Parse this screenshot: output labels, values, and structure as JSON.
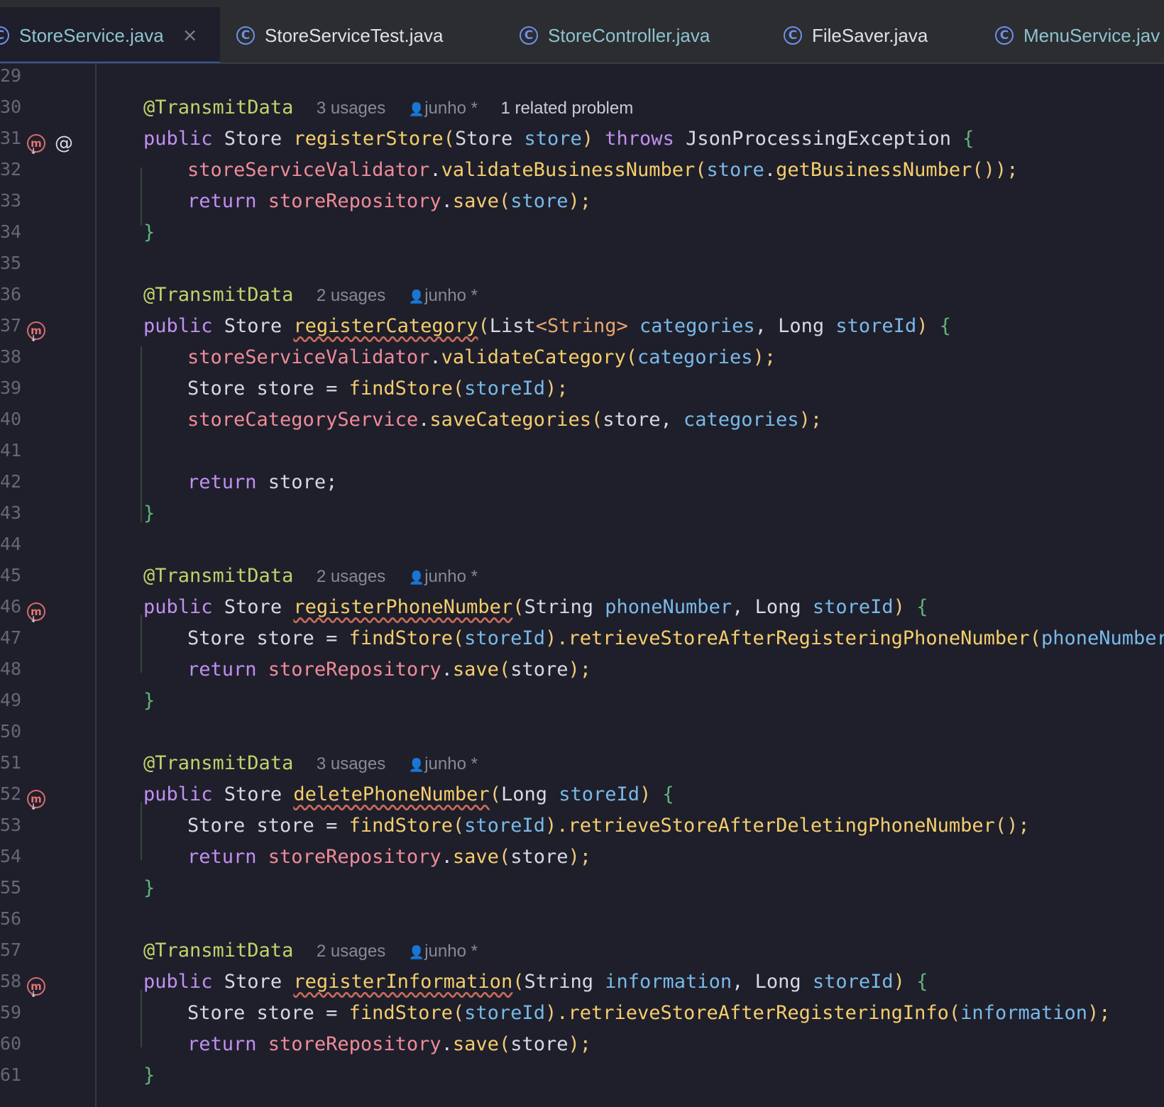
{
  "tabs": [
    {
      "label": "StoreService.java",
      "active": true,
      "close_icon": "×"
    },
    {
      "label": "StoreServiceTest.java"
    },
    {
      "label": "StoreController.java"
    },
    {
      "label": "FileSaver.java"
    },
    {
      "label": "MenuService.jav"
    }
  ],
  "tab_icon": "C",
  "gutter_icons": {
    "implements_method": "m",
    "annotation": "@"
  },
  "editor": {
    "lines": [
      {
        "n": "29"
      },
      {
        "n": "30",
        "annotation": "@TransmitData",
        "usages": "3 usages",
        "author": "junho *",
        "problem": "1 related problem"
      },
      {
        "n": "31",
        "type": "Store",
        "name": "registerStore",
        "params_open": "(",
        "p1type": "Store ",
        "p1": "store",
        "close": ")",
        "throws": " throws ",
        "exception": "JsonProcessingException ",
        "brace": "{"
      },
      {
        "n": "32",
        "field": "storeServiceValidator",
        "dot": ".",
        "call": "validateBusinessNumber",
        "open": "(",
        "arg": "store",
        "dot2": ".",
        "call2": "getBusinessNumber",
        "tail": "());"
      },
      {
        "n": "33",
        "ret": "return ",
        "field": "storeRepository",
        "dot": ".",
        "call": "save",
        "open": "(",
        "arg": "store",
        "tail": ");"
      },
      {
        "n": "34",
        "brace": "}"
      },
      {
        "n": "35"
      },
      {
        "n": "36",
        "annotation": "@TransmitData",
        "usages": "2 usages",
        "author": "junho *"
      },
      {
        "n": "37",
        "type": "Store",
        "name": "registerCategory",
        "p1type": "List",
        "gen": "<String>",
        "p1": "categories",
        "sep": ", ",
        "p2type": "Long ",
        "p2": "storeId",
        "brace": "{"
      },
      {
        "n": "38",
        "field": "storeServiceValidator",
        "dot": ".",
        "call": "validateCategory",
        "arg": "categories",
        "tail": ");"
      },
      {
        "n": "39",
        "decl": "Store store = ",
        "call": "findStore",
        "arg": "storeId",
        "tail": ");"
      },
      {
        "n": "40",
        "field": "storeCategoryService",
        "dot": ".",
        "call": "saveCategories",
        "plain": "store, ",
        "arg": "categories",
        "tail": ");"
      },
      {
        "n": "41"
      },
      {
        "n": "42",
        "ret": "return ",
        "plain": "store;"
      },
      {
        "n": "43",
        "brace": "}"
      },
      {
        "n": "44"
      },
      {
        "n": "45",
        "annotation": "@TransmitData",
        "usages": "2 usages",
        "author": "junho *"
      },
      {
        "n": "46",
        "type": "Store",
        "name": "registerPhoneNumber",
        "p1type": "String ",
        "p1": "phoneNumber",
        "sep": ", ",
        "p2type": "Long ",
        "p2": "storeId",
        "brace": "{"
      },
      {
        "n": "47",
        "decl": "Store store = ",
        "call": "findStore",
        "arg": "storeId",
        "dot": ").",
        "call2": "retrieveStoreAfterRegisteringPhoneNumber",
        "arg2": "phoneNumber",
        "tail": ");"
      },
      {
        "n": "48",
        "ret": "return ",
        "field": "storeRepository",
        "dot": ".",
        "call": "save",
        "plain": "store",
        "tail": ");"
      },
      {
        "n": "49",
        "brace": "}"
      },
      {
        "n": "50"
      },
      {
        "n": "51",
        "annotation": "@TransmitData",
        "usages": "3 usages",
        "author": "junho *"
      },
      {
        "n": "52",
        "type": "Store",
        "name": "deletePhoneNumber",
        "p1type": "Long ",
        "p1": "storeId",
        "brace": "{"
      },
      {
        "n": "53",
        "decl": "Store store = ",
        "call": "findStore",
        "arg": "storeId",
        "dot": ").",
        "call2": "retrieveStoreAfterDeletingPhoneNumber",
        "tail": "();"
      },
      {
        "n": "54",
        "ret": "return ",
        "field": "storeRepository",
        "dot": ".",
        "call": "save",
        "plain": "store",
        "tail": ");"
      },
      {
        "n": "55",
        "brace": "}"
      },
      {
        "n": "56"
      },
      {
        "n": "57",
        "annotation": "@TransmitData",
        "usages": "2 usages",
        "author": "junho *"
      },
      {
        "n": "58",
        "type": "Store",
        "name": "registerInformation",
        "p1type": "String ",
        "p1": "information",
        "sep": ", ",
        "p2type": "Long ",
        "p2": "storeId",
        "brace": "{"
      },
      {
        "n": "59",
        "decl": "Store store = ",
        "call": "findStore",
        "arg": "storeId",
        "dot": ").",
        "call2": "retrieveStoreAfterRegisteringInfo",
        "arg2": "information",
        "tail": ");"
      },
      {
        "n": "60",
        "ret": "return ",
        "field": "storeRepository",
        "dot": ".",
        "call": "save",
        "plain": "store",
        "tail": ");"
      },
      {
        "n": "61",
        "brace": "}"
      }
    ],
    "kw_public": "public ",
    "punct": {
      "open": "(",
      "close": ") ",
      "sp": " "
    }
  }
}
